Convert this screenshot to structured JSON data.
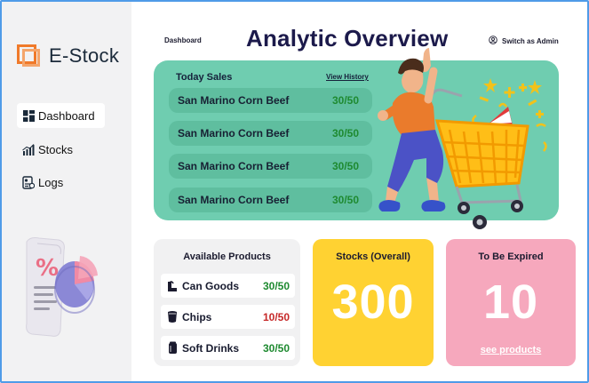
{
  "app": {
    "name": "E-Stock"
  },
  "sidebar": {
    "items": [
      {
        "label": "Dashboard",
        "icon": "dashboard-icon",
        "active": true
      },
      {
        "label": "Stocks",
        "icon": "bar-chart-icon",
        "active": false
      },
      {
        "label": "Logs",
        "icon": "logs-icon",
        "active": false
      }
    ]
  },
  "header": {
    "breadcrumb": "Dashboard",
    "title": "Analytic Overview",
    "switch_label": "Switch as Admin"
  },
  "today_sales": {
    "title": "Today Sales",
    "view_history_label": "View History",
    "rows": [
      {
        "name": "San Marino Corn Beef",
        "count": "30/50"
      },
      {
        "name": "San Marino Corn Beef",
        "count": "30/50"
      },
      {
        "name": "San Marino Corn Beef",
        "count": "30/50"
      },
      {
        "name": "San Marino Corn Beef",
        "count": "30/50"
      }
    ]
  },
  "available_products": {
    "title": "Available Products",
    "rows": [
      {
        "name": "Can Goods",
        "count": "30/50",
        "status_color": "#1e8a30",
        "icon": "can-icon"
      },
      {
        "name": "Chips",
        "count": "10/50",
        "status_color": "#c62828",
        "icon": "chips-icon"
      },
      {
        "name": "Soft Drinks",
        "count": "30/50",
        "status_color": "#1e8a30",
        "icon": "soda-icon"
      }
    ]
  },
  "stocks_overall": {
    "title": "Stocks (Overall)",
    "value": "300"
  },
  "to_be_expired": {
    "title": "To Be Expired",
    "value": "10",
    "link_label": "see products"
  },
  "colors": {
    "accent_orange": "#f07a2a",
    "sales_panel": "#6fcdb0",
    "stocks_card": "#ffd232",
    "expired_card": "#f6a8bd",
    "title_navy": "#1c1a4b"
  }
}
